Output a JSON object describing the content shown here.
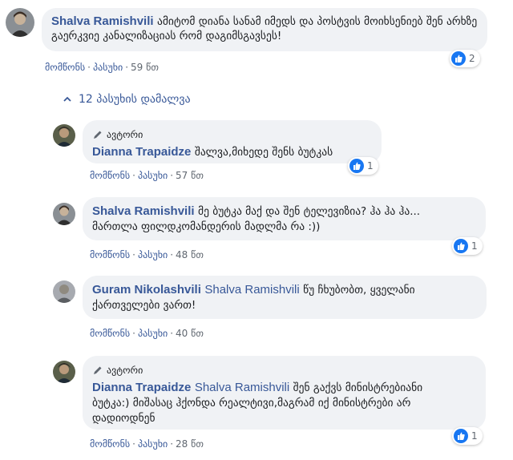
{
  "comment": {
    "author": "Shalva Ramishvili",
    "text": "ამიტომ დიანა სანამ იმედს და პოსტვის მოიხსენიებ შენ არხზე გაერკვიე კანალიზაციას რომ დაგიმსგავსეს!",
    "like_label": "მომწონს",
    "reply_label": "პასუხი",
    "time": "59 წთ",
    "reaction_count": "2"
  },
  "hide_replies_label": "12 პასუხის დამალვა",
  "replies": [
    {
      "author_badge": "ავტორი",
      "author": "Dianna Trapaidze",
      "text": "შალვა,მიხედე შენს ბუტკას",
      "like_label": "მომწონს",
      "reply_label": "პასუხი",
      "time": "57 წთ",
      "reaction_count": "1"
    },
    {
      "author": "Shalva Ramishvili",
      "text_line1": "მე ბუტკა მაქ და შენ ტელევიზია? ჰა ჰა ჰა...",
      "text_line2": "მართლა ფილდკომანდერის მადლმა რა :))",
      "like_label": "მომწონს",
      "reply_label": "პასუხი",
      "time": "48 წთ",
      "reaction_count": "1"
    },
    {
      "author": "Guram Nikolashvili",
      "mention": "Shalva Ramishvili",
      "text_line1": "წუ ჩხუბობთ, ყველანი",
      "text_line2": "ქართველები ვართ!",
      "like_label": "მომწონს",
      "reply_label": "პასუხი",
      "time": "40 წთ"
    },
    {
      "author_badge": "ავტორი",
      "author": "Dianna Trapaidze",
      "mention": "Shalva Ramishvili",
      "text_line1": "შენ გაქვს მინისტრებიანი",
      "text_line2": "ბუტკა:) მიშასაც ჰქონდა რეალტივი,მაგრამ იქ მინისტრები არ",
      "text_line3": "დადიოდნენ",
      "like_label": "მომწონს",
      "reply_label": "პასუხი",
      "time": "28 წთ",
      "reaction_count": "1"
    }
  ],
  "colors": {
    "name": "#385898",
    "bubble": "#f0f2f5",
    "like": "#1877f2",
    "meta": "#606770"
  }
}
